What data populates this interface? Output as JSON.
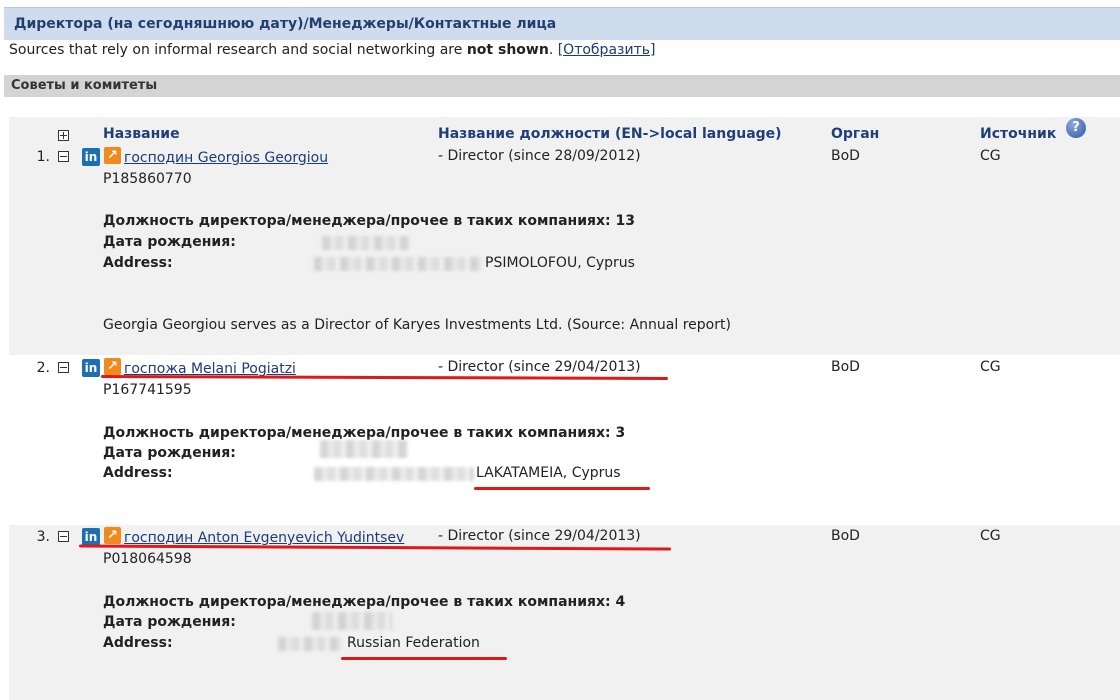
{
  "section": {
    "title": "Директора (на сегодняшнюю дату)/Менеджеры/Контактные лица",
    "note_prefix": "Sources that rely on informal research and social networking are",
    "note_bold": "not shown",
    "note_suffix": ".",
    "show_link": "[Отобразить]"
  },
  "subsection": {
    "title": "Советы и комитеты"
  },
  "columns": {
    "name": "Название",
    "position": "Название должности (EN->local language)",
    "organ": "Орган",
    "source": "Источник",
    "help": "?"
  },
  "labels": {
    "positions_count": "Должность директора/менеджера/прочее в таких компаниях:",
    "birth_date": "Дата рождения:",
    "address": "Address:"
  },
  "persons": [
    {
      "num": "1.",
      "name": "господин Georgios Georgiou",
      "id": "P185860770",
      "position": "- Director (since 28/09/2012)",
      "organ": "BoD",
      "source": "CG",
      "positions_count": "13",
      "address": "PSIMOLOFOU, Cyprus",
      "note": "Georgia Georgiou serves as a Director of Karyes Investments Ltd. (Source: Annual report)"
    },
    {
      "num": "2.",
      "name": "госпожа Melani Pogiatzi",
      "id": "P167741595",
      "position": "- Director (since 29/04/2013)",
      "organ": "BoD",
      "source": "CG",
      "positions_count": "3",
      "address": "LAKATAMEIA, Cyprus"
    },
    {
      "num": "3.",
      "name": "господин Anton Evgenyevich Yudintsev",
      "id": "P018064598",
      "position": "- Director (since 29/04/2013)",
      "organ": "BoD",
      "source": "CG",
      "positions_count": "4",
      "address": "Russian Federation"
    }
  ],
  "icons": {
    "linkedin": "in",
    "external": "↗"
  },
  "colors": {
    "header_bg": "#cfdcee",
    "link": "#1a3b7c",
    "annotation_red": "#e01818"
  }
}
